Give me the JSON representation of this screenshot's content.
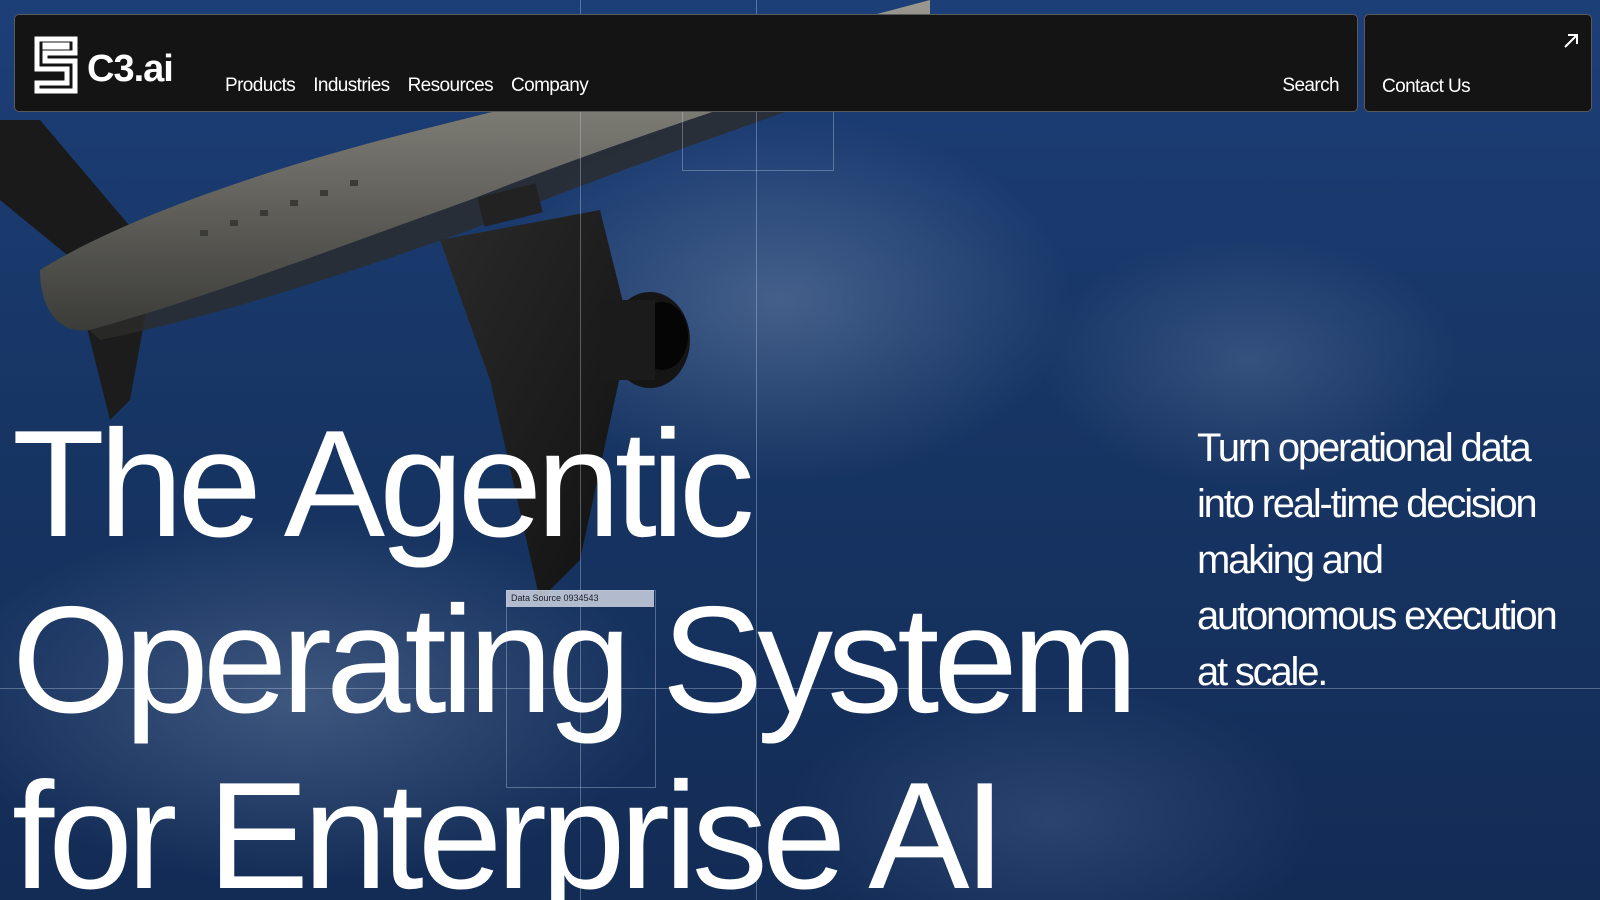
{
  "brand": {
    "name": "C3.ai"
  },
  "nav": {
    "items": [
      {
        "label": "Products"
      },
      {
        "label": "Industries"
      },
      {
        "label": "Resources"
      },
      {
        "label": "Company"
      }
    ],
    "search_label": "Search",
    "contact_label": "Contact Us"
  },
  "hero": {
    "headline_lines": [
      "The Agentic",
      "Operating System",
      "for Enterprise AI"
    ],
    "subtext": "Turn operational data into real-time decision making and autonomous execution at scale.",
    "data_tag": "Data Source 0934543"
  },
  "icons": {
    "logo": "c3-logo-icon",
    "contact": "arrow-up-right-icon"
  },
  "colors": {
    "nav_background": "#141414",
    "nav_border": "#5a5a5a",
    "sky": "#173564",
    "text": "#ffffff"
  }
}
